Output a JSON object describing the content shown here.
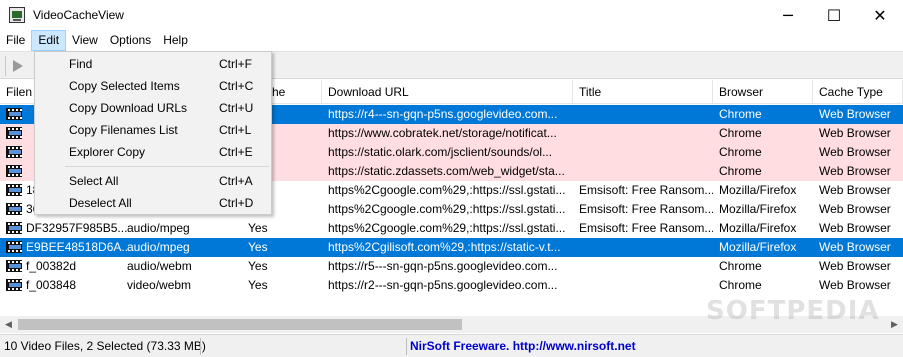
{
  "window": {
    "title": "VideoCacheView",
    "controls": [
      "─",
      "☐",
      "✕"
    ]
  },
  "menubar": {
    "items": [
      "File",
      "Edit",
      "View",
      "Options",
      "Help"
    ]
  },
  "toolbar": {
    "play_icon": "play-icon"
  },
  "columns": [
    "Filen",
    "",
    "che",
    "Download URL",
    "Title",
    "Browser",
    "Cache Type"
  ],
  "rows": [
    {
      "state": "selected",
      "filename": "",
      "type": "",
      "cache": "",
      "url": "https://r4---sn-gqn-p5ns.googlevideo.com...",
      "title": "",
      "browser": "Chrome",
      "cache_type": "Web Browser"
    },
    {
      "state": "pink",
      "filename": "",
      "type": "",
      "cache": "",
      "url": "https://www.cobratek.net/storage/notificat...",
      "title": "",
      "browser": "Chrome",
      "cache_type": "Web Browser"
    },
    {
      "state": "pink",
      "filename": "",
      "type": "",
      "cache": "",
      "url": "https://static.olark.com/jsclient/sounds/ol...",
      "title": "",
      "browser": "Chrome",
      "cache_type": "Web Browser"
    },
    {
      "state": "pink",
      "filename": "",
      "type": "",
      "cache": "",
      "url": "https://static.zdassets.com/web_widget/sta...",
      "title": "",
      "browser": "Chrome",
      "cache_type": "Web Browser"
    },
    {
      "state": "normal",
      "filename": "18",
      "type": "",
      "cache": "",
      "url": "https%2Cgoogle.com%29,:https://ssl.gstati...",
      "title": "Emsisoft: Free Ransom...",
      "browser": "Mozilla/Firefox",
      "cache_type": "Web Browser"
    },
    {
      "state": "normal",
      "filename": "36",
      "type": "",
      "cache": "",
      "url": "https%2Cgoogle.com%29,:https://ssl.gstati...",
      "title": "Emsisoft: Free Ransom...",
      "browser": "Mozilla/Firefox",
      "cache_type": "Web Browser"
    },
    {
      "state": "normal",
      "filename": "DF32957F985B5...",
      "type": "audio/mpeg",
      "cache": "Yes",
      "url": "https%2Cgoogle.com%29,:https://ssl.gstati...",
      "title": "Emsisoft: Free Ransom...",
      "browser": "Mozilla/Firefox",
      "cache_type": "Web Browser"
    },
    {
      "state": "selected",
      "filename": "E9BEE48518D6A...",
      "type": "audio/mpeg",
      "cache": "Yes",
      "url": "https%2Cgilisoft.com%29,:https://static-v.t...",
      "title": "",
      "browser": "Mozilla/Firefox",
      "cache_type": "Web Browser"
    },
    {
      "state": "normal",
      "filename": "f_00382d",
      "type": "audio/webm",
      "cache": "Yes",
      "url": "https://r5---sn-gqn-p5ns.googlevideo.com...",
      "title": "",
      "browser": "Chrome",
      "cache_type": "Web Browser"
    },
    {
      "state": "normal",
      "filename": "f_003848",
      "type": "video/webm",
      "cache": "Yes",
      "url": "https://r2---sn-gqn-p5ns.googlevideo.com...",
      "title": "",
      "browser": "Chrome",
      "cache_type": "Web Browser"
    }
  ],
  "edit_menu": {
    "items": [
      {
        "label": "Find",
        "shortcut": "Ctrl+F"
      },
      {
        "label": "Copy Selected Items",
        "shortcut": "Ctrl+C"
      },
      {
        "label": "Copy Download URLs",
        "shortcut": "Ctrl+U"
      },
      {
        "label": "Copy Filenames List",
        "shortcut": "Ctrl+L"
      },
      {
        "label": "Explorer Copy",
        "shortcut": "Ctrl+E"
      },
      {
        "label": "Select All",
        "shortcut": "Ctrl+A"
      },
      {
        "label": "Deselect All",
        "shortcut": "Ctrl+D"
      }
    ]
  },
  "statusbar": {
    "summary": "10 Video Files, 2 Selected  (73.33 MB)",
    "link": "NirSoft Freeware.  http://www.nirsoft.net"
  },
  "watermark": "SOFTPEDIA",
  "colors": {
    "selected_row": "#0078d7",
    "pink_row": "#ffdde0",
    "menu_active": "#cce8ff",
    "status_link": "#0000cc"
  }
}
